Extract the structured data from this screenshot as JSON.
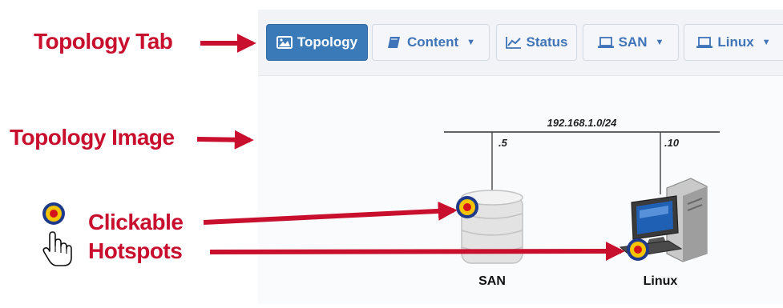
{
  "tabs": [
    {
      "label": "Topology",
      "icon": "image-icon",
      "active": true,
      "dropdown": false
    },
    {
      "label": "Content",
      "icon": "book-icon",
      "active": false,
      "dropdown": true
    },
    {
      "label": "Status",
      "icon": "line-chart-icon",
      "active": false,
      "dropdown": false
    },
    {
      "label": "SAN",
      "icon": "laptop-icon",
      "active": false,
      "dropdown": true
    },
    {
      "label": "Linux",
      "icon": "laptop-icon",
      "active": false,
      "dropdown": true
    }
  ],
  "annotations": {
    "topology_tab": "Topology Tab",
    "topology_image": "Topology Image",
    "clickable": "Clickable",
    "hotspots": "Hotspots"
  },
  "topology": {
    "network": "192.168.1.0/24",
    "san_octet": ".5",
    "linux_octet": ".10",
    "san_label": "SAN",
    "linux_label": "Linux"
  },
  "colors": {
    "accent": "#3b7ab8",
    "annotation_red": "#c8102e",
    "hotspot_ring": "#1e3a8a",
    "hotspot_fill": "#f5c400",
    "hotspot_core": "#d4141c"
  }
}
